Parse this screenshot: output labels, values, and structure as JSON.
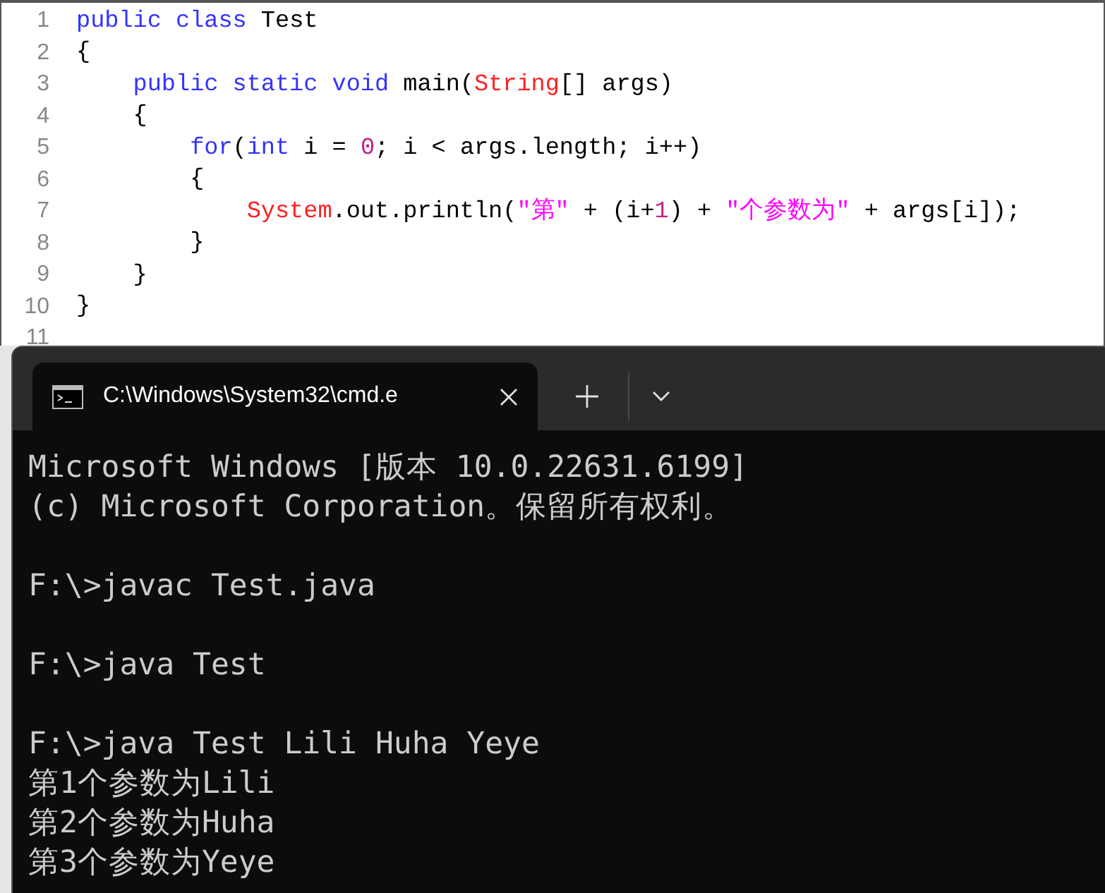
{
  "editor": {
    "lines": [
      {
        "number": "1",
        "tokens": [
          {
            "text": "public class",
            "kind": "keyword"
          },
          {
            "text": " Test",
            "kind": "plain"
          }
        ]
      },
      {
        "number": "2",
        "tokens": [
          {
            "text": "{",
            "kind": "plain"
          }
        ]
      },
      {
        "number": "3",
        "tokens": [
          {
            "text": "    public static void",
            "kind": "keyword"
          },
          {
            "text": " main(",
            "kind": "plain"
          },
          {
            "text": "String",
            "kind": "type"
          },
          {
            "text": "[] args)",
            "kind": "plain"
          }
        ]
      },
      {
        "number": "4",
        "tokens": [
          {
            "text": "    {",
            "kind": "plain"
          }
        ]
      },
      {
        "number": "5",
        "tokens": [
          {
            "text": "        for",
            "kind": "keyword"
          },
          {
            "text": "(",
            "kind": "plain"
          },
          {
            "text": "int",
            "kind": "keyword"
          },
          {
            "text": " i = ",
            "kind": "plain"
          },
          {
            "text": "0",
            "kind": "number"
          },
          {
            "text": "; i < args.length; i++)",
            "kind": "plain"
          }
        ]
      },
      {
        "number": "6",
        "tokens": [
          {
            "text": "        {",
            "kind": "plain"
          }
        ]
      },
      {
        "number": "7",
        "tokens": [
          {
            "text": "            System",
            "kind": "type"
          },
          {
            "text": ".out.println(",
            "kind": "plain"
          },
          {
            "text": "\"第\"",
            "kind": "string"
          },
          {
            "text": " + (i+",
            "kind": "plain"
          },
          {
            "text": "1",
            "kind": "number"
          },
          {
            "text": ") + ",
            "kind": "plain"
          },
          {
            "text": "\"个参数为\"",
            "kind": "string"
          },
          {
            "text": " + args[i]);",
            "kind": "plain"
          }
        ]
      },
      {
        "number": "8",
        "tokens": [
          {
            "text": "        }",
            "kind": "plain"
          }
        ]
      },
      {
        "number": "9",
        "tokens": [
          {
            "text": "    }",
            "kind": "plain"
          }
        ]
      },
      {
        "number": "10",
        "tokens": [
          {
            "text": "}",
            "kind": "plain"
          }
        ]
      },
      {
        "number": "11"
      }
    ]
  },
  "terminal": {
    "tab": {
      "title": "C:\\Windows\\System32\\cmd.e",
      "selected": true
    },
    "blocks": [
      [
        "Microsoft Windows [版本 10.0.22631.6199]",
        "(c) Microsoft Corporation。保留所有权利。"
      ],
      [
        "F:\\>javac Test.java"
      ],
      [
        "F:\\>java Test"
      ],
      [
        "F:\\>java Test Lili Huha Yeye",
        "第1个参数为Lili",
        "第2个参数为Huha",
        "第3个参数为Yeye"
      ]
    ]
  }
}
